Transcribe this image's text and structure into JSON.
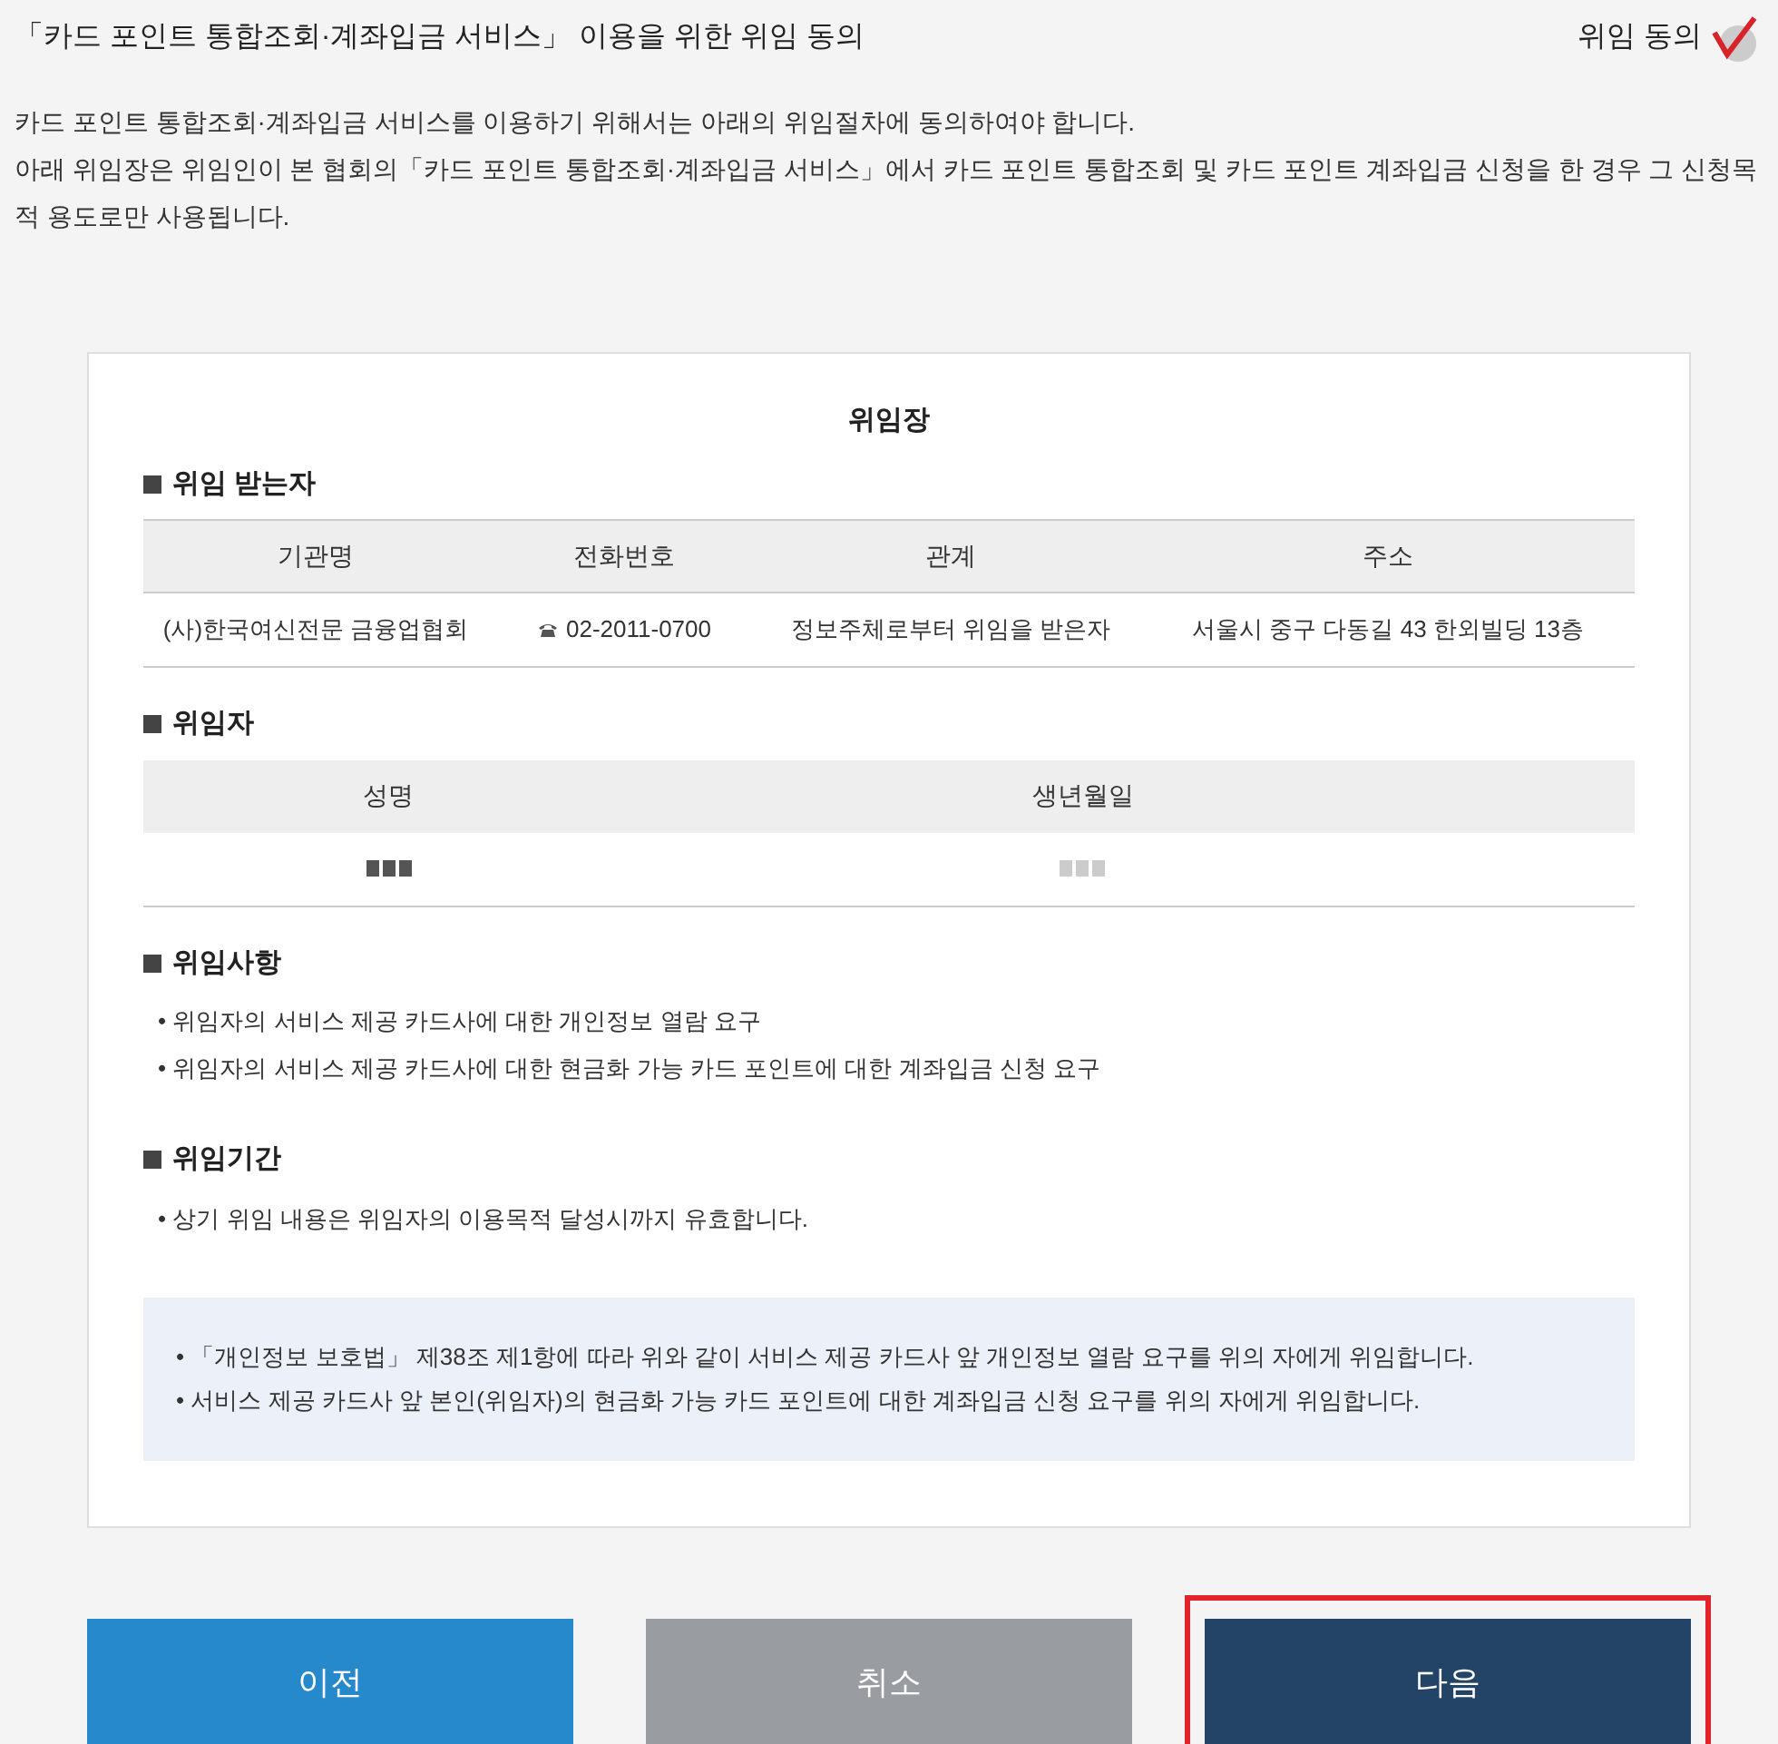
{
  "header": {
    "title": "「카드 포인트 통합조회·계좌입금 서비스」 이용을 위한 위임 동의",
    "consent": {
      "label": "위임 동의",
      "checked": true
    }
  },
  "intro": [
    "카드 포인트 통합조회·계좌입금 서비스를 이용하기 위해서는 아래의 위임절차에 동의하여야 합니다.",
    "아래 위임장은 위임인이 본 협회의「카드 포인트 통합조회·계좌입금 서비스」에서 카드 포인트 통합조회 및 카드 포인트 계좌입금 신청을 한 경우 그 신청목적 용도로만 사용됩니다."
  ],
  "document": {
    "title": "위임장",
    "delegate": {
      "heading": "위임 받는자",
      "columns": [
        "기관명",
        "전화번호",
        "관계",
        "주소"
      ],
      "row": [
        "(사)한국여신전문 금융업협회",
        "02-2011-0700",
        "정보주체로부터 위임을 받은자",
        "서울시 중구 다동길 43 한외빌딩 13층"
      ]
    },
    "delegator": {
      "heading": "위임자",
      "columns": [
        "성명",
        "생년월일"
      ]
    },
    "matters": {
      "heading": "위임사항",
      "items": [
        "• 위임자의 서비스 제공 카드사에 대한 개인정보 열람 요구",
        "• 위임자의 서비스 제공 카드사에 대한 현금화 가능 카드 포인트에 대한 계좌입금 신청 요구"
      ]
    },
    "period": {
      "heading": "위임기간",
      "items": [
        "• 상기 위임 내용은 위임자의 이용목적 달성시까지 유효합니다."
      ]
    },
    "notice": [
      "• 「개인정보 보호법」 제38조 제1항에 따라 위와 같이 서비스 제공 카드사 앞 개인정보 열람 요구를 위의 자에게 위임합니다.",
      "• 서비스 제공 카드사 앞 본인(위임자)의 현금화 가능 카드 포인트에 대한 계좌입금 신청 요구를 위의 자에게 위임합니다."
    ]
  },
  "buttons": [
    {
      "label": "이전",
      "kind": "prev",
      "highlighted": false
    },
    {
      "label": "취소",
      "kind": "cancel",
      "highlighted": false
    },
    {
      "label": "다음",
      "kind": "next",
      "highlighted": true
    }
  ]
}
